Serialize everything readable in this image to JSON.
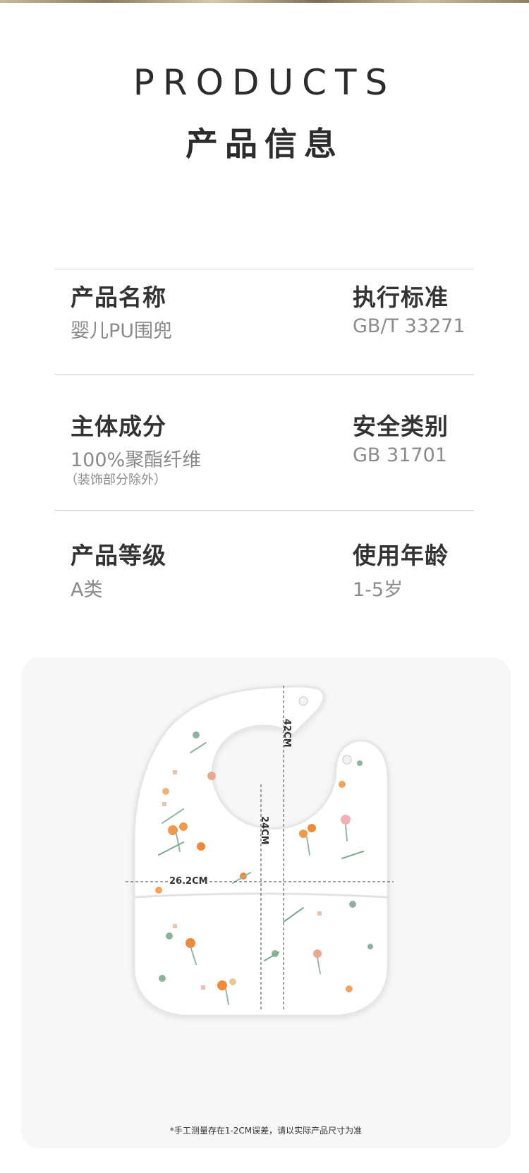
{
  "header": {
    "title_en": "PRODUCTS",
    "title_cn": "产品信息"
  },
  "specs": [
    {
      "label": "产品名称",
      "value": "婴儿PU围兜"
    },
    {
      "label": "执行标准",
      "value": "GB/T 33271"
    },
    {
      "label": "主体成分",
      "value": "100%聚酯纤维",
      "note": "（装饰部分除外）"
    },
    {
      "label": "安全类别",
      "value": "GB 31701"
    },
    {
      "label": "产品等级",
      "value": "A类"
    },
    {
      "label": "使用年龄",
      "value": "1-5岁"
    }
  ],
  "product_image": {
    "dimensions": {
      "length": "42CM",
      "pocket_height": "24CM",
      "width": "26.2CM"
    },
    "footnote": "*手工测量存在1-2CM误差，请以实际产品尺寸为准"
  }
}
